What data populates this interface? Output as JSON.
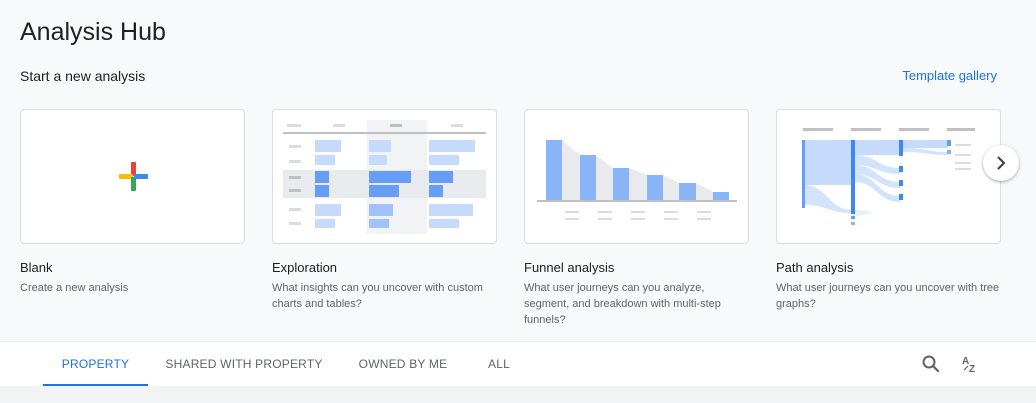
{
  "header": {
    "title": "Analysis Hub",
    "subtitle": "Start a new analysis",
    "template_gallery": "Template gallery"
  },
  "cards": [
    {
      "title": "Blank",
      "description": "Create a new analysis",
      "thumb": "plus-icon"
    },
    {
      "title": "Exploration",
      "description": "What insights can you uncover with custom charts and tables?",
      "thumb": "exploration-preview"
    },
    {
      "title": "Funnel analysis",
      "description": "What user journeys can you analyze, segment, and breakdown with multi-step funnels?",
      "thumb": "funnel-preview"
    },
    {
      "title": "Path analysis",
      "description": "What user journeys can you uncover with tree graphs?",
      "thumb": "path-preview"
    }
  ],
  "carousel": {
    "next_icon": "chevron-right-icon"
  },
  "tabs": [
    {
      "label": "PROPERTY",
      "active": true
    },
    {
      "label": "SHARED WITH PROPERTY",
      "active": false
    },
    {
      "label": "OWNED BY ME",
      "active": false
    },
    {
      "label": "ALL",
      "active": false
    }
  ],
  "tools": {
    "search_icon": "search-icon",
    "sort_icon": "sort-az-icon"
  },
  "colors": {
    "accent": "#1a73e8",
    "chart_blue": "#8ab4f8",
    "chart_blue_dark": "#669df6",
    "plus_red": "#ea4335",
    "plus_yellow": "#fbbc04",
    "plus_green": "#34a853",
    "plus_blue": "#4285f4"
  }
}
